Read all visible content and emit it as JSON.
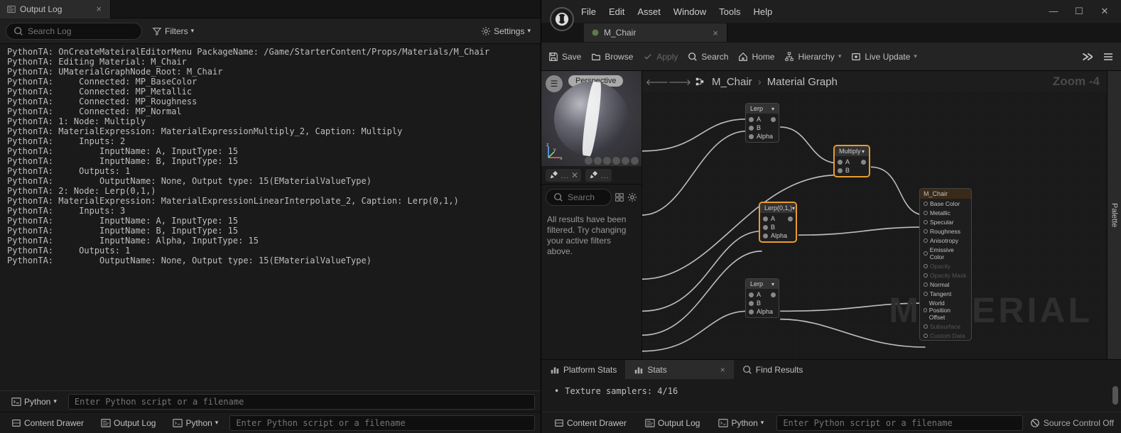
{
  "left": {
    "tab": {
      "title": "Output Log"
    },
    "search": {
      "placeholder": "Search Log"
    },
    "filters_label": "Filters",
    "settings_label": "Settings",
    "log_lines": [
      "PythonTA: OnCreateMateiralEditorMenu PackageName: /Game/StarterContent/Props/Materials/M_Chair",
      "PythonTA: Editing Material: M_Chair",
      "PythonTA: UMaterialGraphNode_Root: M_Chair",
      "PythonTA:     Connected: MP_BaseColor",
      "PythonTA:     Connected: MP_Metallic",
      "PythonTA:     Connected: MP_Roughness",
      "PythonTA:     Connected: MP_Normal",
      "PythonTA: 1: Node: Multiply",
      "PythonTA: MaterialExpression: MaterialExpressionMultiply_2, Caption: Multiply",
      "PythonTA:     Inputs: 2",
      "PythonTA:         InputName: A, InputType: 15",
      "PythonTA:         InputName: B, InputType: 15",
      "PythonTA:     Outputs: 1",
      "PythonTA:         OutputName: None, Output type: 15(EMaterialValueType)",
      "PythonTA: 2: Node: Lerp(0,1,)",
      "PythonTA: MaterialExpression: MaterialExpressionLinearInterpolate_2, Caption: Lerp(0,1,)",
      "PythonTA:     Inputs: 3",
      "PythonTA:         InputName: A, InputType: 15",
      "PythonTA:         InputName: B, InputType: 15",
      "PythonTA:         InputName: Alpha, InputType: 15",
      "PythonTA:     Outputs: 1",
      "PythonTA:         OutputName: None, Output type: 15(EMaterialValueType)"
    ],
    "python_label": "Python",
    "python_placeholder": "Enter Python script or a filename",
    "footer": {
      "content_drawer": "Content Drawer",
      "output_log": "Output Log",
      "python": "Python",
      "cmd_placeholder": "Enter Python script or a filename"
    }
  },
  "right": {
    "menu": {
      "file": "File",
      "edit": "Edit",
      "asset": "Asset",
      "window": "Window",
      "tools": "Tools",
      "help": "Help"
    },
    "tab_title": "M_Chair",
    "toolbar": {
      "save": "Save",
      "browse": "Browse",
      "apply": "Apply",
      "search": "Search",
      "home": "Home",
      "hierarchy": "Hierarchy",
      "live_update": "Live Update"
    },
    "preview": {
      "view_mode": "Perspective"
    },
    "palette_search": {
      "placeholder": "Search"
    },
    "filter_message": "All results have been filtered. Try changing your active filters above.",
    "palette_label": "Palette",
    "graph": {
      "breadcrumb": {
        "root": "M_Chair",
        "sub": "Material Graph"
      },
      "zoom": "Zoom -4",
      "watermark": "MATERIAL",
      "nodes": {
        "lerp1": {
          "title": "Lerp",
          "pins": [
            "A",
            "B",
            "Alpha"
          ]
        },
        "multiply": {
          "title": "Multiply",
          "pins": [
            "A",
            "B"
          ]
        },
        "lerp2": {
          "title": "Lerp(0,1,)",
          "pins": [
            "A",
            "B",
            "Alpha"
          ]
        },
        "lerp3": {
          "title": "Lerp",
          "pins": [
            "A",
            "B",
            "Alpha"
          ]
        },
        "result": {
          "title": "M_Chair",
          "pins": [
            "Base Color",
            "Metallic",
            "Specular",
            "Roughness",
            "Anisotropy",
            "Emissive Color",
            "Opacity",
            "Opacity Mask",
            "Normal",
            "Tangent",
            "World Position Offset",
            "Subsurface",
            "Custom Data"
          ]
        }
      }
    },
    "bottom_tabs": {
      "platform_stats": "Platform Stats",
      "stats": "Stats",
      "find_results": "Find Results"
    },
    "stats_line": "Texture samplers: 4/16",
    "footer": {
      "content_drawer": "Content Drawer",
      "output_log": "Output Log",
      "python": "Python",
      "cmd_placeholder": "Enter Python script or a filename",
      "source_control": "Source Control Off"
    }
  }
}
